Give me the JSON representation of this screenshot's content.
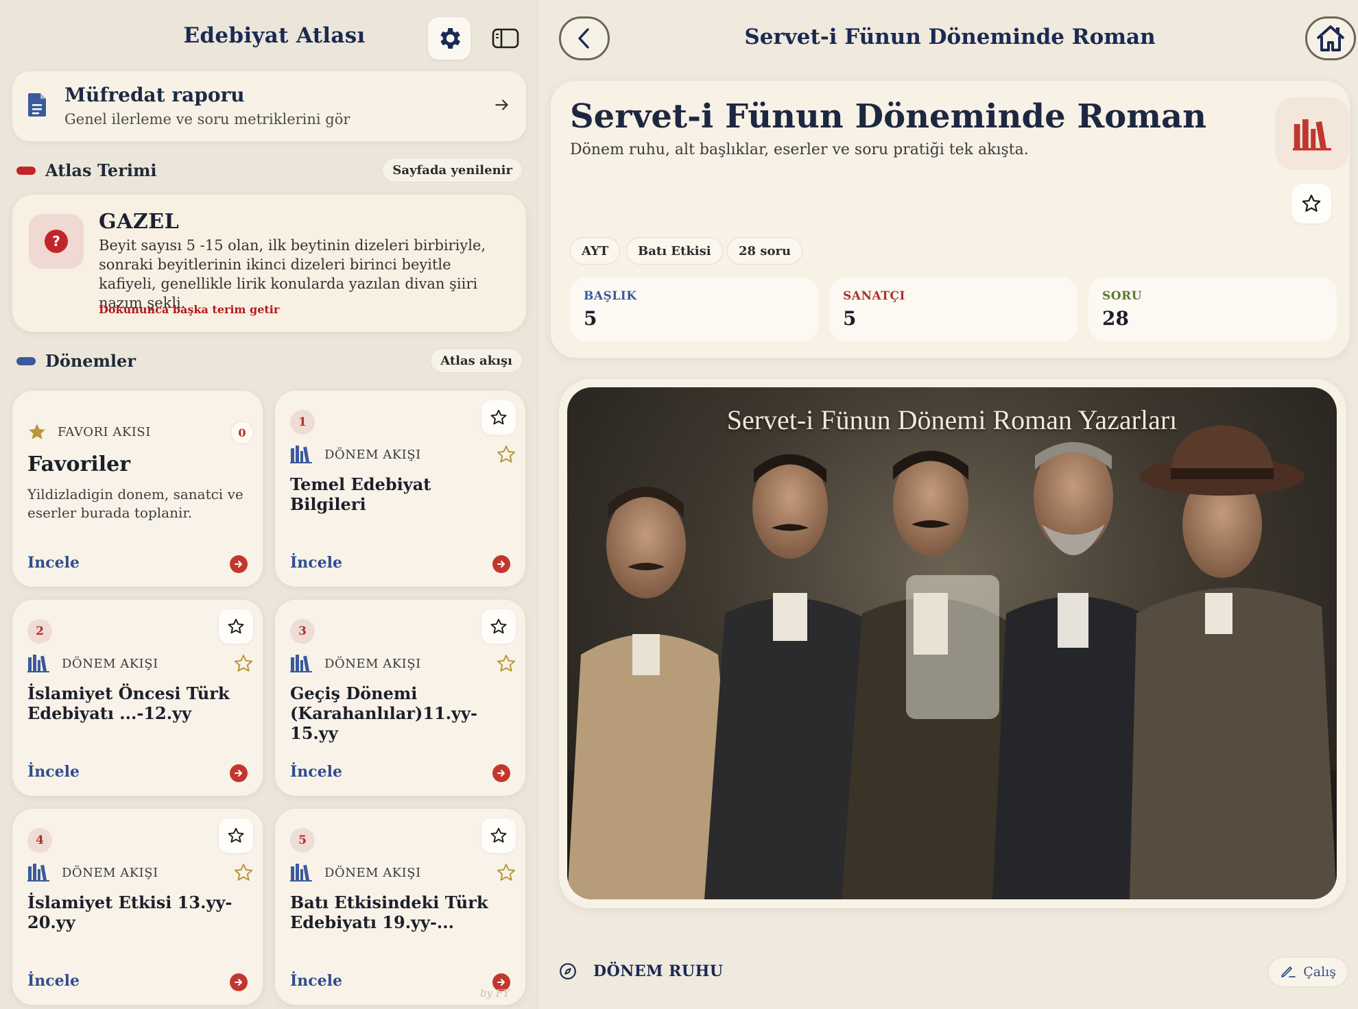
{
  "sidebar": {
    "title": "Edebiyat Atlası",
    "report": {
      "title": "Müfredat raporu",
      "subtitle": "Genel ilerleme ve soru metriklerini gör"
    },
    "term_section": {
      "label": "Atlas Terimi",
      "pill": "Sayfada yenilenir",
      "dot_color": "#c1242a"
    },
    "term_card": {
      "title": "GAZEL",
      "description": "Beyit sayısı 5 -15 olan, ilk beytinin dizeleri birbiriyle, sonraki beyitlerinin ikinci dizeleri birinci beyitle kafiyeli, genellikle lirik konularda yazılan divan şiiri nazım şekli.",
      "hint": "Dokununca başka terim getir"
    },
    "periods_section": {
      "label": "Dönemler",
      "pill": "Atlas akışı",
      "dot_color": "#3a5a9c"
    },
    "favorites_card": {
      "kicker": "FAVORI AKISI",
      "count": "0",
      "title": "Favoriler",
      "description": "Yildizladigin donem, sanatci ve eserler burada toplanir.",
      "action": "Incele"
    },
    "period_cards": [
      {
        "number": "1",
        "kicker": "DÖNEM AKIŞI",
        "title": "Temel Edebiyat Bilgileri",
        "action": "İncele"
      },
      {
        "number": "2",
        "kicker": "DÖNEM AKIŞI",
        "title": "İslamiyet Öncesi Türk Edebiyatı ...-12.yy",
        "action": "İncele"
      },
      {
        "number": "3",
        "kicker": "DÖNEM AKIŞI",
        "title": "Geçiş Dönemi (Karahanlılar)11.yy-15.yy",
        "action": "İncele"
      },
      {
        "number": "4",
        "kicker": "DÖNEM AKIŞI",
        "title": "İslamiyet Etkisi 13.yy-20.yy",
        "action": "İncele"
      },
      {
        "number": "5",
        "kicker": "DÖNEM AKIŞI",
        "title": "Batı Etkisindeki Türk Edebiyatı 19.yy-...",
        "action": "İncele"
      }
    ],
    "byline": "by FY"
  },
  "main": {
    "header_title": "Servet-i Fünun Döneminde Roman",
    "hero": {
      "title": "Servet-i Fünun Döneminde Roman",
      "subtitle": "Dönem ruhu, alt başlıklar, eserler ve soru pratiği tek akışta.",
      "tags": [
        "AYT",
        "Batı Etkisi",
        "28 soru"
      ],
      "stats": [
        {
          "label": "BAŞLIK",
          "value": "5",
          "color": "#3a5a9c"
        },
        {
          "label": "SANATÇI",
          "value": "5",
          "color": "#b0302a"
        },
        {
          "label": "SORU",
          "value": "28",
          "color": "#5a7a2a"
        }
      ]
    },
    "photo": {
      "caption": "Servet-i Fünun Dönemi Roman Yazarları"
    },
    "section": {
      "label": "DÖNEM RUHU",
      "action": "Çalış"
    }
  },
  "colors": {
    "accent_navy": "#1b2a52",
    "accent_red": "#c1372e",
    "link_blue": "#2f4d8f",
    "star_gold": "#b8963a"
  }
}
